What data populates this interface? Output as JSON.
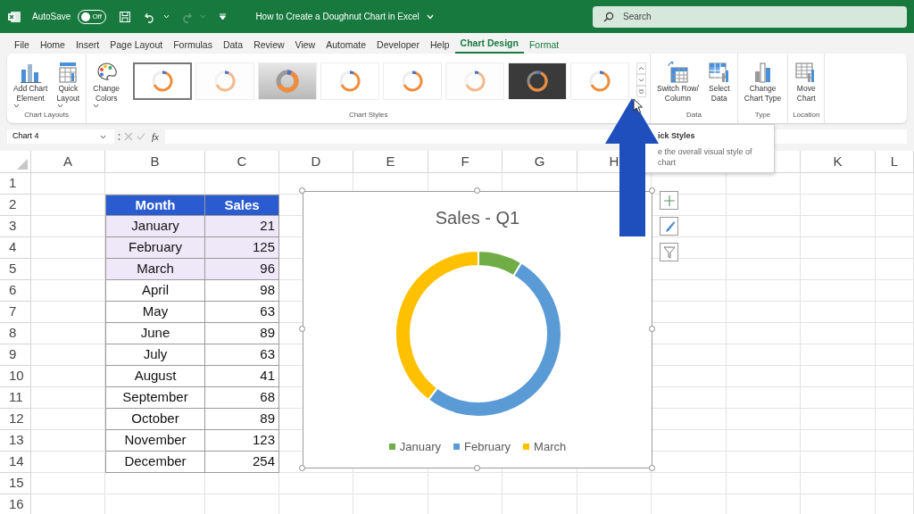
{
  "title_bar": {
    "autosave_label": "AutoSave",
    "autosave": {
      "on": false,
      "label": "Off"
    },
    "redo_disabled": true,
    "document_title": "How to Create a Doughnut Chart in Excel",
    "search": {
      "placeholder": "Search"
    }
  },
  "tabs": [
    {
      "label": "File",
      "selected": false,
      "contextual": false
    },
    {
      "label": "Home",
      "selected": false,
      "contextual": false
    },
    {
      "label": "Insert",
      "selected": false,
      "contextual": false
    },
    {
      "label": "Page Layout",
      "selected": false,
      "contextual": false
    },
    {
      "label": "Formulas",
      "selected": false,
      "contextual": false
    },
    {
      "label": "Data",
      "selected": false,
      "contextual": false
    },
    {
      "label": "Review",
      "selected": false,
      "contextual": false
    },
    {
      "label": "View",
      "selected": false,
      "contextual": false
    },
    {
      "label": "Automate",
      "selected": false,
      "contextual": false
    },
    {
      "label": "Developer",
      "selected": false,
      "contextual": false
    },
    {
      "label": "Help",
      "selected": false,
      "contextual": false
    },
    {
      "label": "Chart Design",
      "selected": true,
      "contextual": true
    },
    {
      "label": "Format",
      "selected": false,
      "contextual": true
    }
  ],
  "ribbon": {
    "groups": [
      {
        "label": "Chart Layouts",
        "buttons": [
          {
            "kind": "add-element",
            "lines": [
              "Add Chart",
              "Element"
            ],
            "dropdown": true
          },
          {
            "kind": "quick-layout",
            "lines": [
              "Quick",
              "Layout"
            ],
            "dropdown": true
          }
        ]
      },
      {
        "label": "Chart Styles",
        "buttons": [
          {
            "kind": "colors",
            "lines": [
              "Change",
              "Colors"
            ],
            "dropdown": true
          }
        ],
        "styles": [
          {
            "kind": "light",
            "selected": true
          },
          {
            "kind": "faint",
            "selected": false
          },
          {
            "kind": "gray",
            "selected": false
          },
          {
            "kind": "light",
            "selected": false
          },
          {
            "kind": "light",
            "selected": false
          },
          {
            "kind": "faint",
            "selected": false
          },
          {
            "kind": "dark",
            "selected": false
          },
          {
            "kind": "light",
            "selected": false
          }
        ]
      },
      {
        "label": "Data",
        "buttons": [
          {
            "kind": "switch",
            "lines": [
              "Switch Row/",
              "Column"
            ],
            "dropdown": false
          },
          {
            "kind": "select-data",
            "lines": [
              "Select",
              "Data"
            ],
            "dropdown": false
          }
        ]
      },
      {
        "label": "Type",
        "buttons": [
          {
            "kind": "chart-type",
            "lines": [
              "Change",
              "Chart Type"
            ],
            "dropdown": false
          }
        ]
      },
      {
        "label": "Location",
        "buttons": [
          {
            "kind": "move",
            "lines": [
              "Move",
              "Chart"
            ],
            "dropdown": false
          }
        ]
      }
    ]
  },
  "formula_bar": {
    "name_box": "Chart 4",
    "function_label": "fx"
  },
  "sheet": {
    "column_headers": [
      "A",
      "B",
      "C",
      "D",
      "E",
      "F",
      "G",
      "H"
    ],
    "column_headers_right": [
      "K",
      "L"
    ],
    "row_numbers": [
      "1",
      "2",
      "3",
      "4",
      "5",
      "6",
      "7",
      "8",
      "9",
      "10",
      "11",
      "12",
      "13",
      "14",
      "15",
      "16"
    ],
    "table": {
      "columns": [
        "Month",
        "Sales"
      ],
      "rows": [
        {
          "month": "January",
          "sales": "21",
          "in_chart_range": true
        },
        {
          "month": "February",
          "sales": "125",
          "in_chart_range": true
        },
        {
          "month": "March",
          "sales": "96",
          "in_chart_range": true
        },
        {
          "month": "April",
          "sales": "98",
          "in_chart_range": false
        },
        {
          "month": "May",
          "sales": "63",
          "in_chart_range": false
        },
        {
          "month": "June",
          "sales": "89",
          "in_chart_range": false
        },
        {
          "month": "July",
          "sales": "63",
          "in_chart_range": false
        },
        {
          "month": "August",
          "sales": "41",
          "in_chart_range": false
        },
        {
          "month": "September",
          "sales": "68",
          "in_chart_range": false
        },
        {
          "month": "October",
          "sales": "89",
          "in_chart_range": false
        },
        {
          "month": "November",
          "sales": "123",
          "in_chart_range": false
        },
        {
          "month": "December",
          "sales": "254",
          "in_chart_range": false
        }
      ]
    }
  },
  "chart": {
    "chart_data": {
      "type": "donut",
      "title": "Sales - Q1",
      "categories": [
        "January",
        "February",
        "March"
      ],
      "values": [
        8.68,
        51.65,
        39.67
      ]
    },
    "legend": [
      {
        "color": "#70ad47"
      },
      {
        "color": "#5b9bd5"
      },
      {
        "color": "#ffc000"
      }
    ]
  },
  "tooltip": {
    "title": "ick Styles",
    "description": "e the overall visual style of chart"
  }
}
